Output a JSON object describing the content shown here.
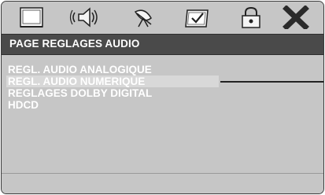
{
  "icons": [
    {
      "name": "general-setup-icon"
    },
    {
      "name": "audio-setup-icon"
    },
    {
      "name": "video-setup-icon"
    },
    {
      "name": "preference-setup-icon"
    },
    {
      "name": "password-lock-icon"
    },
    {
      "name": "exit-icon"
    }
  ],
  "page": {
    "title": "PAGE REGLAGES AUDIO"
  },
  "menu": {
    "items": [
      {
        "label": "REGL. AUDIO ANALOGIQUE",
        "selected": false
      },
      {
        "label": "REGL. AUDIO NUMERIQUE",
        "selected": true
      },
      {
        "label": "REGLAGES DOLBY DIGITAL",
        "selected": false
      },
      {
        "label": "HDCD",
        "selected": false
      }
    ]
  },
  "colors": {
    "panel": "#c6c6c6",
    "title_bar": "#4a4a4a",
    "text": "#ffffff",
    "highlight": "#d8d8d8"
  }
}
